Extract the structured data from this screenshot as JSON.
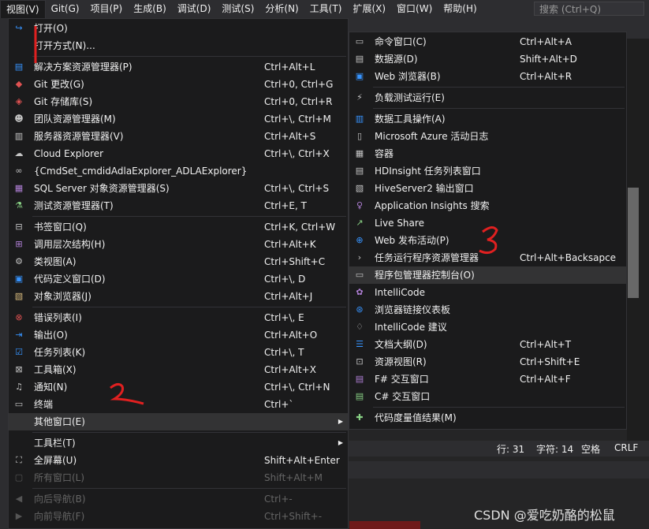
{
  "menubar": {
    "items": [
      "视图(V)",
      "Git(G)",
      "项目(P)",
      "生成(B)",
      "调试(D)",
      "测试(S)",
      "分析(N)",
      "工具(T)",
      "扩展(X)",
      "窗口(W)",
      "帮助(H)"
    ],
    "search_placeholder": "搜索 (Ctrl+Q)"
  },
  "main_menu": {
    "items": [
      {
        "icon": "open-icon",
        "label": "打开(O)",
        "shortcut": ""
      },
      {
        "icon": "none",
        "label": "打开方式(N)...",
        "shortcut": ""
      },
      {
        "icon": "solution-explorer-icon",
        "label": "解决方案资源管理器(P)",
        "shortcut": "Ctrl+Alt+L"
      },
      {
        "icon": "git-changes-icon",
        "label": "Git 更改(G)",
        "shortcut": "Ctrl+0, Ctrl+G"
      },
      {
        "icon": "git-repository-icon",
        "label": "Git 存储库(S)",
        "shortcut": "Ctrl+0, Ctrl+R"
      },
      {
        "icon": "team-explorer-icon",
        "label": "团队资源管理器(M)",
        "shortcut": "Ctrl+\\, Ctrl+M"
      },
      {
        "icon": "server-explorer-icon",
        "label": "服务器资源管理器(V)",
        "shortcut": "Ctrl+Alt+S"
      },
      {
        "icon": "cloud-icon",
        "label": "Cloud Explorer",
        "shortcut": "Ctrl+\\, Ctrl+X"
      },
      {
        "icon": "binoculars-icon",
        "label": "{CmdSet_cmdidAdlaExplorer_ADLAExplorer}",
        "shortcut": ""
      },
      {
        "icon": "sql-server-icon",
        "label": "SQL Server 对象资源管理器(S)",
        "shortcut": "Ctrl+\\, Ctrl+S"
      },
      {
        "icon": "test-explorer-icon",
        "label": "测试资源管理器(T)",
        "shortcut": "Ctrl+E, T"
      },
      {
        "icon": "bookmark-icon",
        "label": "书签窗口(Q)",
        "shortcut": "Ctrl+K, Ctrl+W"
      },
      {
        "icon": "call-hierarchy-icon",
        "label": "调用层次结构(H)",
        "shortcut": "Ctrl+Alt+K"
      },
      {
        "icon": "class-view-icon",
        "label": "类视图(A)",
        "shortcut": "Ctrl+Shift+C"
      },
      {
        "icon": "code-definition-icon",
        "label": "代码定义窗口(D)",
        "shortcut": "Ctrl+\\, D"
      },
      {
        "icon": "object-browser-icon",
        "label": "对象浏览器(J)",
        "shortcut": "Ctrl+Alt+J"
      },
      {
        "icon": "error-list-icon",
        "label": "错误列表(I)",
        "shortcut": "Ctrl+\\, E"
      },
      {
        "icon": "output-icon",
        "label": "输出(O)",
        "shortcut": "Ctrl+Alt+O"
      },
      {
        "icon": "task-list-icon",
        "label": "任务列表(K)",
        "shortcut": "Ctrl+\\, T"
      },
      {
        "icon": "toolbox-icon",
        "label": "工具箱(X)",
        "shortcut": "Ctrl+Alt+X"
      },
      {
        "icon": "bell-icon",
        "label": "通知(N)",
        "shortcut": "Ctrl+\\, Ctrl+N"
      },
      {
        "icon": "terminal-icon",
        "label": "终端",
        "shortcut": "Ctrl+`"
      },
      {
        "icon": "none",
        "label": "其他窗口(E)",
        "shortcut": ""
      },
      {
        "icon": "none",
        "label": "工具栏(T)",
        "shortcut": ""
      },
      {
        "icon": "fullscreen-icon",
        "label": "全屏幕(U)",
        "shortcut": "Shift+Alt+Enter"
      },
      {
        "icon": "all-windows-icon",
        "label": "所有窗口(L)",
        "shortcut": "Shift+Alt+M"
      },
      {
        "icon": "navigate-back-icon",
        "label": "向后导航(B)",
        "shortcut": "Ctrl+-"
      },
      {
        "icon": "navigate-forward-icon",
        "label": "向前导航(F)",
        "shortcut": "Ctrl+Shift+-"
      }
    ]
  },
  "sub_menu": {
    "items": [
      {
        "icon": "command-window-icon",
        "label": "命令窗口(C)",
        "shortcut": "Ctrl+Alt+A"
      },
      {
        "icon": "data-source-icon",
        "label": "数据源(D)",
        "shortcut": "Shift+Alt+D"
      },
      {
        "icon": "web-browser-icon",
        "label": "Web 浏览器(B)",
        "shortcut": "Ctrl+Alt+R"
      },
      {
        "icon": "load-test-icon",
        "label": "负载测试运行(E)",
        "shortcut": ""
      },
      {
        "icon": "data-tools-icon",
        "label": "数据工具操作(A)",
        "shortcut": ""
      },
      {
        "icon": "azure-log-icon",
        "label": "Microsoft Azure 活动日志",
        "shortcut": ""
      },
      {
        "icon": "container-icon",
        "label": "容器",
        "shortcut": ""
      },
      {
        "icon": "hdinsight-icon",
        "label": "HDInsight 任务列表窗口",
        "shortcut": ""
      },
      {
        "icon": "hiveserver-icon",
        "label": "HiveServer2 输出窗口",
        "shortcut": ""
      },
      {
        "icon": "app-insights-icon",
        "label": "Application Insights 搜索",
        "shortcut": ""
      },
      {
        "icon": "live-share-icon",
        "label": "Live Share",
        "shortcut": ""
      },
      {
        "icon": "web-publish-icon",
        "label": "Web 发布活动(P)",
        "shortcut": ""
      },
      {
        "icon": "task-runner-icon",
        "label": "任务运行程序资源管理器",
        "shortcut": "Ctrl+Alt+Backsapce"
      },
      {
        "icon": "package-manager-console-icon",
        "label": "程序包管理器控制台(O)",
        "shortcut": ""
      },
      {
        "icon": "intellicode-icon",
        "label": "IntelliCode",
        "shortcut": ""
      },
      {
        "icon": "browser-link-icon",
        "label": "浏览器链接仪表板",
        "shortcut": ""
      },
      {
        "icon": "intellicode-suggest-icon",
        "label": "IntelliCode 建议",
        "shortcut": ""
      },
      {
        "icon": "document-outline-icon",
        "label": "文档大纲(D)",
        "shortcut": "Ctrl+Alt+T"
      },
      {
        "icon": "resource-view-icon",
        "label": "资源视图(R)",
        "shortcut": "Ctrl+Shift+E"
      },
      {
        "icon": "fsharp-interactive-icon",
        "label": "F# 交互窗口",
        "shortcut": "Ctrl+Alt+F"
      },
      {
        "icon": "csharp-interactive-icon",
        "label": "C# 交互窗口",
        "shortcut": ""
      },
      {
        "icon": "code-metrics-icon",
        "label": "代码度量值结果(M)",
        "shortcut": ""
      }
    ]
  },
  "status_bar": {
    "line": "行: 31",
    "char": "字符: 14",
    "space": "空格",
    "eol": "CRLF"
  },
  "watermark": "CSDN @爱吃奶酪的松鼠",
  "colors": {
    "menu_bg": "#1b1b1c",
    "highlight": "#333334",
    "accent": "#3794ff"
  }
}
